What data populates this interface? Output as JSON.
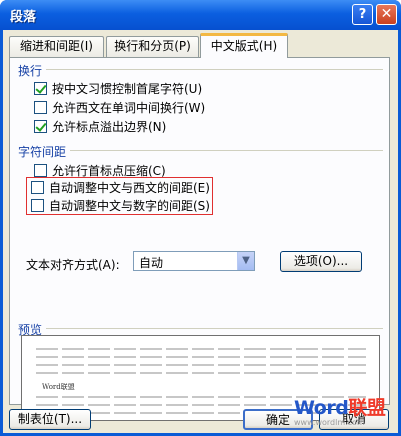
{
  "window": {
    "title": "段落",
    "help_label": "?",
    "close_label": "✕"
  },
  "tabs": [
    {
      "label": "缩进和间距(I)"
    },
    {
      "label": "换行和分页(P)"
    },
    {
      "label": "中文版式(H)",
      "active": true
    }
  ],
  "line_break": {
    "title": "换行",
    "options": [
      {
        "label": "按中文习惯控制首尾字符(U)",
        "checked": true
      },
      {
        "label": "允许西文在单词中间换行(W)",
        "checked": false
      },
      {
        "label": "允许标点溢出边界(N)",
        "checked": true
      }
    ]
  },
  "char_spacing": {
    "title": "字符间距",
    "options": [
      {
        "label": "允许行首标点压缩(C)",
        "checked": false
      },
      {
        "label": "自动调整中文与西文的间距(E)",
        "checked": false
      },
      {
        "label": "自动调整中文与数字的间距(S)",
        "checked": false
      }
    ]
  },
  "text_align": {
    "label": "文本对齐方式(A):",
    "value": "自动",
    "dropdown_icon": "chevron-down-icon"
  },
  "options_button": "选项(O)...",
  "preview": {
    "title": "预览",
    "sample_word": "Word联盟"
  },
  "footer": {
    "tabs_button": "制表位(T)...",
    "ok_button": "确定",
    "cancel_button": "取消"
  },
  "watermark": {
    "brand_part1": "Word",
    "brand_part2": "联盟",
    "url": "www.wordlm.com"
  },
  "colors": {
    "titlebar": "#0b5fe0",
    "section_title": "#1842a6",
    "highlight": "#e03030",
    "check": "#21a121"
  }
}
